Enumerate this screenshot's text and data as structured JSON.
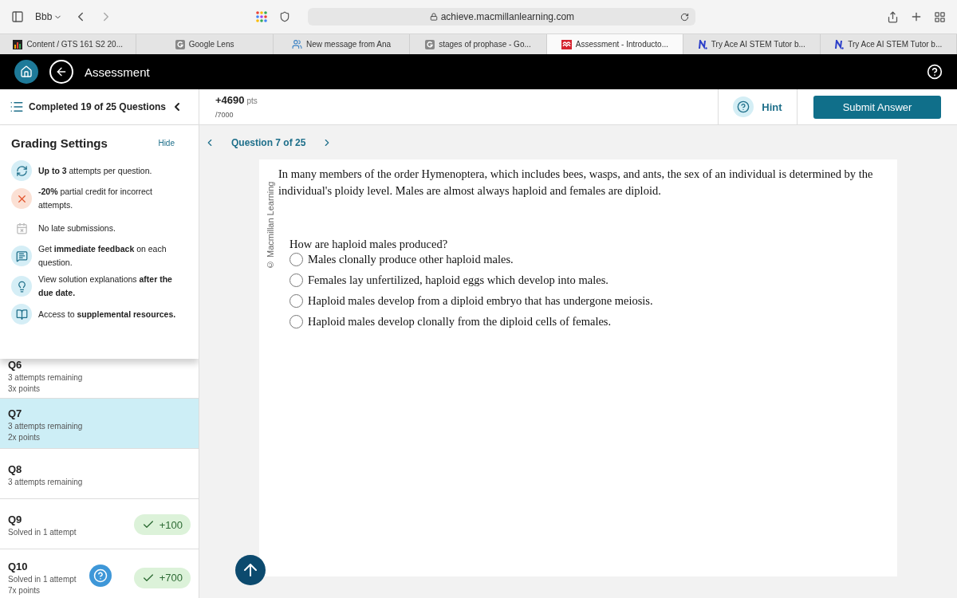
{
  "browser": {
    "profile": "Bbb",
    "address": "achieve.macmillanlearning.com",
    "tabs": [
      {
        "label": "Content / GTS 161 S2 20...",
        "kind": "bars",
        "selected": false
      },
      {
        "label": "Google Lens",
        "kind": "g",
        "selected": false
      },
      {
        "label": "New message from Ana",
        "kind": "people",
        "selected": false
      },
      {
        "label": "stages of prophase - Go...",
        "kind": "g",
        "selected": false
      },
      {
        "label": "Assessment - Introducto...",
        "kind": "macmillan",
        "selected": true
      },
      {
        "label": "Try Ace AI STEM Tutor b...",
        "kind": "n",
        "selected": false
      },
      {
        "label": "Try Ace AI STEM Tutor b...",
        "kind": "n",
        "selected": false
      }
    ]
  },
  "app_bar": {
    "title": "Assessment"
  },
  "progress": {
    "label": "Completed 19 of 25 Questions"
  },
  "score": {
    "points": "+4690",
    "unit": "pts",
    "total": "/7000"
  },
  "hint": "Hint",
  "submit": "Submit Answer",
  "grading": {
    "title": "Grading Settings",
    "hide": "Hide",
    "items": [
      {
        "kind": "attempts",
        "text": "**Up to 3** attempts per question."
      },
      {
        "kind": "penalty",
        "text": "**-20%** partial credit for incorrect attempts."
      },
      {
        "kind": "late",
        "text": "No late submissions."
      },
      {
        "kind": "feedback",
        "text": "Get **immediate feedback** on each question."
      },
      {
        "kind": "solution",
        "text": "View solution explanations **after the due date.**"
      },
      {
        "kind": "resources",
        "text": "Access to **supplemental resources.**"
      }
    ]
  },
  "questions": [
    {
      "label": "Q6",
      "lines": [
        "3 attempts remaining",
        "3x points"
      ],
      "selected": false
    },
    {
      "label": "Q7",
      "lines": [
        "3 attempts remaining",
        "2x points"
      ],
      "selected": true
    },
    {
      "label": "Q8",
      "lines": [
        "3 attempts remaining"
      ],
      "selected": false
    },
    {
      "label": "Q9",
      "lines": [
        "Solved in 1 attempt"
      ],
      "badge": "+100",
      "selected": false
    },
    {
      "label": "Q10",
      "lines": [
        "Solved in 1 attempt",
        "7x points"
      ],
      "badge": "+700",
      "selected": false
    }
  ],
  "question_nav": {
    "label": "Question 7 of 25"
  },
  "copyright": "© Macmillan Learning",
  "stem": "In many members of the order Hymenoptera, which includes bees, wasps, and ants, the sex of an individual is determined by the individual's ploidy level. Males are almost always haploid and females are diploid.",
  "prompt": "How are haploid males produced?",
  "options": [
    {
      "text": "Males clonally produce other haploid males.",
      "selected": false
    },
    {
      "text": "Females lay unfertilized, haploid eggs which develop into males.",
      "selected": false
    },
    {
      "text": "Haploid males develop from a diploid embryo that has undergone meiosis.",
      "selected": false
    },
    {
      "text": "Haploid males develop clonally from the diploid cells of  females.",
      "selected": false
    }
  ]
}
